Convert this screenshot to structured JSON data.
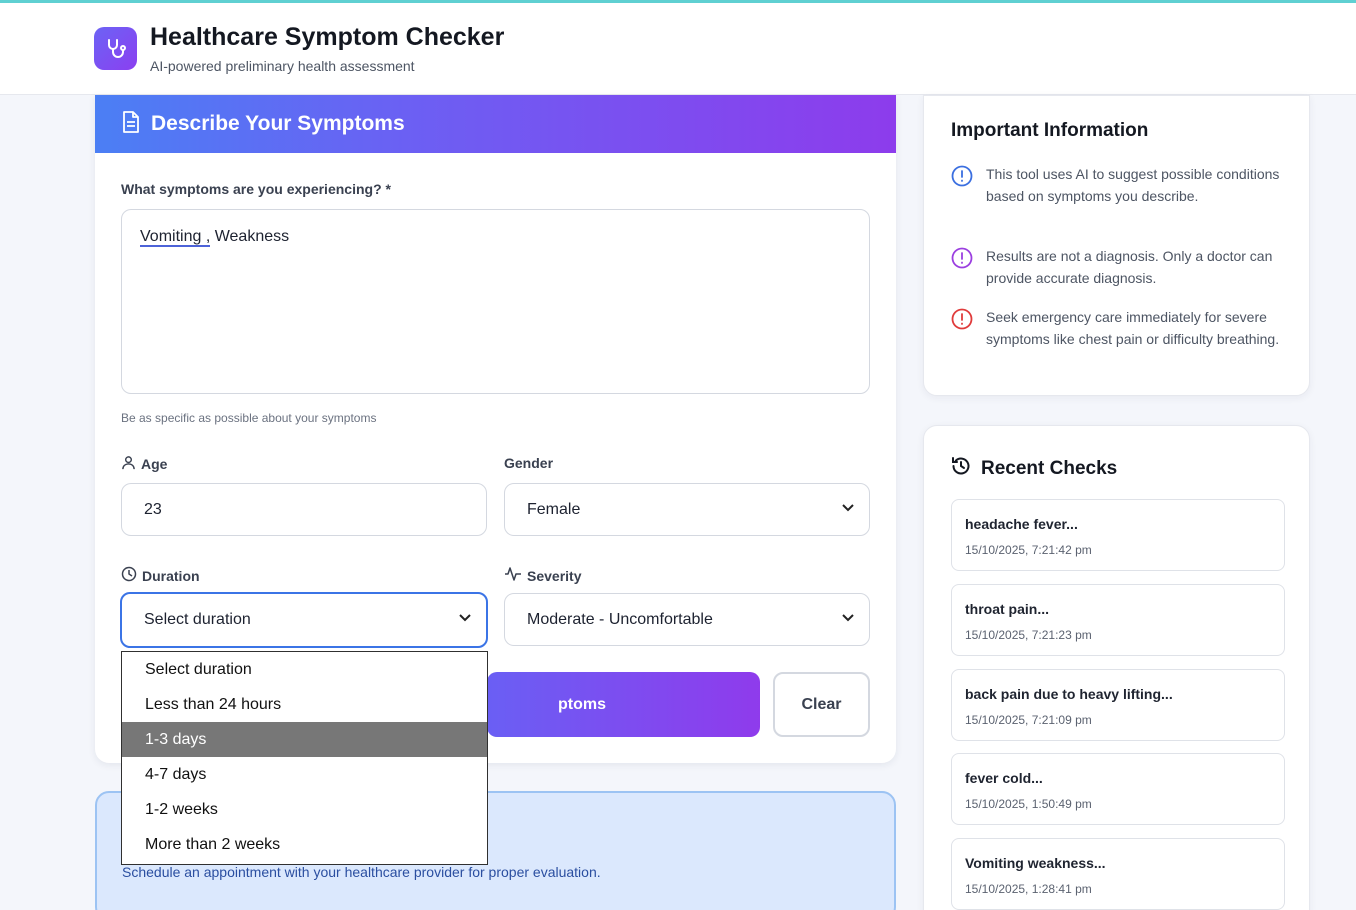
{
  "header": {
    "title": "Healthcare Symptom Checker",
    "subtitle": "AI-powered preliminary health assessment"
  },
  "form": {
    "heading": "Describe Your Symptoms",
    "symptoms_label": "What symptoms are you experiencing? *",
    "symptoms_word1": "Vomiting ,",
    "symptoms_word2": " Weakness",
    "symptoms_hint": "Be as specific as possible about your symptoms",
    "age_label": "Age",
    "age_value": "23",
    "gender_label": "Gender",
    "gender_value": "Female",
    "duration_label": "Duration",
    "duration_value": "Select duration",
    "severity_label": "Severity",
    "severity_value": "Moderate - Uncomfortable",
    "analyze_label_visible": "ptoms",
    "clear_label": "Clear",
    "duration_options": [
      "Select duration",
      "Less than 24 hours",
      "1-3 days",
      "4-7 days",
      "1-2 weeks",
      "More than 2 weeks"
    ],
    "duration_highlighted_index": 2
  },
  "advice": {
    "text": "Schedule an appointment with your healthcare provider for proper evaluation."
  },
  "info": {
    "heading": "Important Information",
    "items": [
      {
        "text": "This tool uses AI to suggest possible conditions based on symptoms you describe.",
        "color": "#3b6fe0"
      },
      {
        "text": "Results are not a diagnosis. Only a doctor can provide accurate diagnosis.",
        "color": "#9b3fe0"
      },
      {
        "text": "Seek emergency care immediately for severe symptoms like chest pain or difficulty breathing.",
        "color": "#e03b3b"
      }
    ]
  },
  "recent": {
    "heading": "Recent Checks",
    "items": [
      {
        "title": "headache fever...",
        "date": "15/10/2025, 7:21:42 pm"
      },
      {
        "title": "throat pain...",
        "date": "15/10/2025, 7:21:23 pm"
      },
      {
        "title": "back pain due to heavy lifting...",
        "date": "15/10/2025, 7:21:09 pm"
      },
      {
        "title": "fever cold...",
        "date": "15/10/2025, 1:50:49 pm"
      },
      {
        "title": "Vomiting weakness...",
        "date": "15/10/2025, 1:28:41 pm"
      }
    ]
  },
  "colors": {
    "accent_start": "#4b7ff4",
    "accent_end": "#8d3cec",
    "focus_border": "#3b74e6",
    "advice_bg": "#dbe8fd"
  }
}
